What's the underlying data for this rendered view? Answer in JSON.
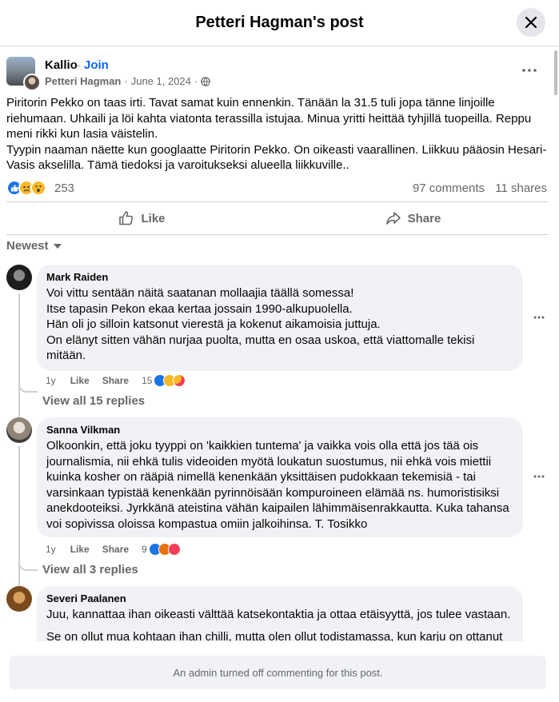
{
  "header": {
    "title": "Petteri Hagman's post"
  },
  "post": {
    "group": "Kallio",
    "separator": "·",
    "join": "Join",
    "author": "Petteri Hagman",
    "date": "June 1, 2024",
    "meta_sep": "·",
    "text_1": "Piritorin Pekko on taas irti. Tavat samat kuin ennenkin. Tänään la 31.5 tuli jopa tänne linjoille riehumaan. Uhkaili ja löi kahta viatonta terassilla istujaa. Minua yritti heittää tyhjillä tuopeilla. Reppu meni rikki kun lasia väistelin.",
    "text_2": "Tyypin naaman näette kun googlaatte Piritorin Pekko. On oikeasti vaarallinen. Liikkuu pääosin Hesari-Vasis akselilla. Tämä tiedoksi ja varoitukseksi alueella liikkuville..",
    "reaction_count": "253",
    "comments": "97 comments",
    "shares": "11 shares"
  },
  "actions": {
    "like": "Like",
    "share": "Share"
  },
  "sort": {
    "label": "Newest"
  },
  "comments": [
    {
      "name": "Mark Raiden",
      "text": "Voi vittu sentään näitä saatanan mollaajia täällä somessa!\nItse tapasin Pekon ekaa kertaa jossain 1990-alkupuolella.\nHän oli jo silloin katsonut vierestä ja kokenut aikamoisia juttuja.\nOn elänyt sitten vähän nurjaa puolta, mutta en osaa uskoa, että viattomalle tekisi mitään.",
      "age": "1y",
      "like": "Like",
      "share": "Share",
      "reactions": "15",
      "replies": "View all 15 replies"
    },
    {
      "name": "Sanna Vilkman",
      "text": "Olkoonkin, että joku tyyppi on 'kaikkien tuntema' ja vaikka vois olla että jos tää ois journalismia, nii ehkä tulis videoiden myötä loukatun suostumus, nii ehkä vois miettii kuinka kosher on rääpiä nimellä kenenkään yksittäisen pudokkaan tekemisiä - tai varsinkaan typistää kenenkään pyrinnöisään kompuroineen elämää ns. humoristisiksi anekdooteiksi. Jyrkkänä ateistina vähän kaipailen lähimmäisenrakkautta. Kuka tahansa voi sopivissa oloissa kompastua omiin jalkoihinsa. T. Tosikko",
      "age": "1y",
      "like": "Like",
      "share": "Share",
      "reactions": "9",
      "replies": "View all 3 replies"
    },
    {
      "name": "Severi Paalanen",
      "text": "Juu, kannattaa ihan oikeasti välttää katsekontaktia ja ottaa etäisyyttä, jos tulee vastaan.",
      "text_2": "Se on ollut mua kohtaan ihan chilli, mutta olen ollut todistamassa, kun karju on ottanut"
    }
  ],
  "footer": {
    "notice": "An admin turned off commenting for this post."
  },
  "colors": {
    "accent": "#0866ff",
    "secondary_text": "#65676b",
    "bubble": "#f0f2f5"
  },
  "icons": [
    "close-icon",
    "more-icon",
    "globe-icon",
    "like-icon",
    "share-icon",
    "chevron-down-icon"
  ]
}
